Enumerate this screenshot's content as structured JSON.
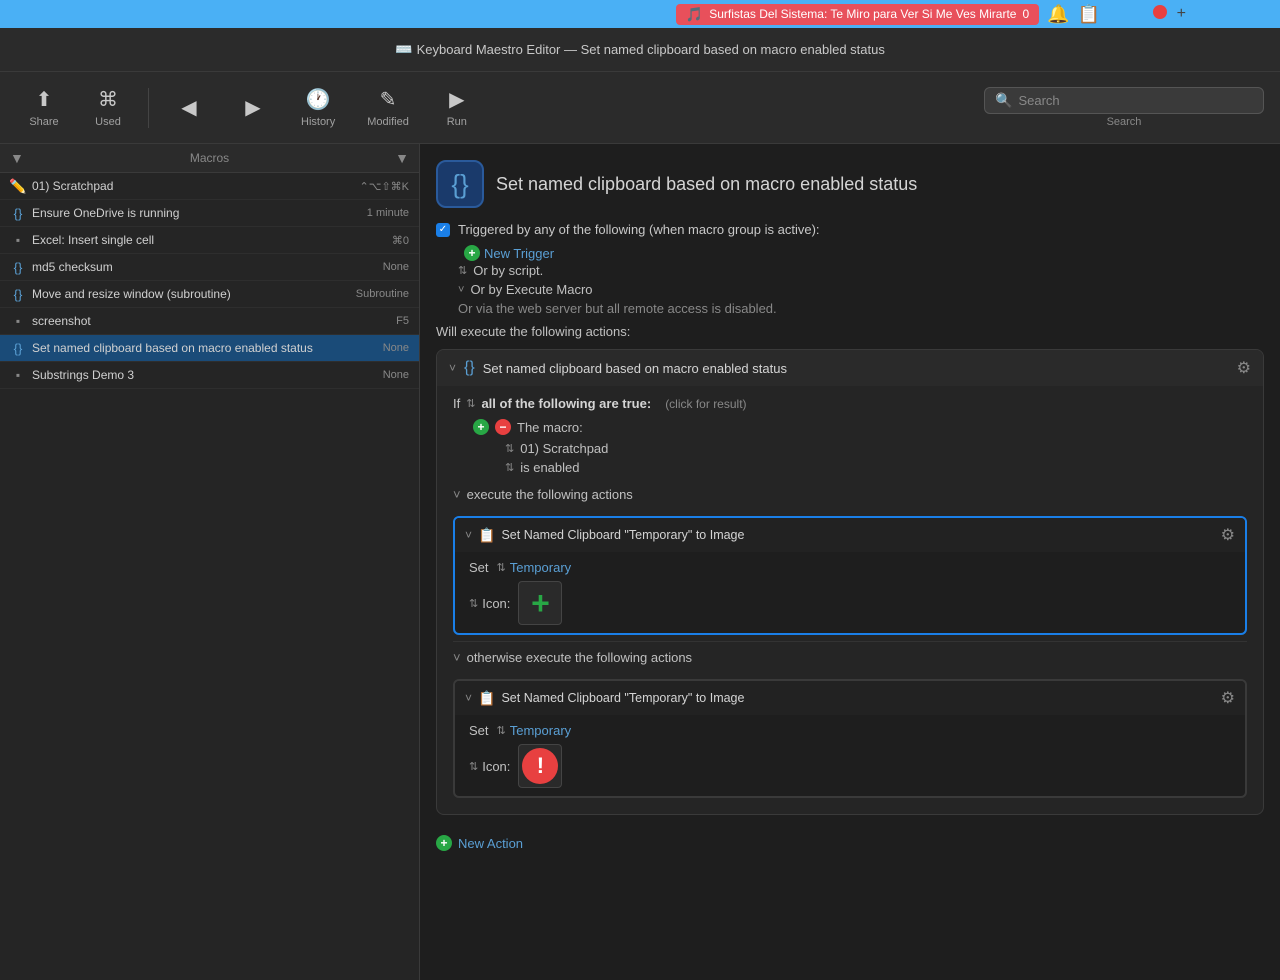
{
  "menubar": {
    "music_title": "Surfistas Del Sistema: Te Miro para Ver Si Me Ves Mirarte",
    "music_count": "0"
  },
  "titlebar": {
    "title": "Keyboard Maestro Editor — Set named clipboard based on macro enabled status"
  },
  "toolbar": {
    "share_label": "Share",
    "used_label": "Used",
    "history_label": "History",
    "modified_label": "Modified",
    "run_label": "Run",
    "search_placeholder": "Search",
    "search_label": "Search"
  },
  "sidebar": {
    "header": "Macros",
    "macros": [
      {
        "name": "01) Scratchpad",
        "shortcut": "⌃⌥⇧⌘K",
        "icon": "pencil",
        "selected": false
      },
      {
        "name": "Ensure OneDrive is running",
        "shortcut": "1 minute",
        "icon": "curly",
        "selected": false
      },
      {
        "name": "Excel: Insert single cell",
        "shortcut": "⌘0",
        "icon": "grid",
        "selected": false
      },
      {
        "name": "md5 checksum",
        "shortcut": "None",
        "icon": "curly",
        "selected": false
      },
      {
        "name": "Move and resize window (subroutine)",
        "shortcut": "Subroutine",
        "icon": "curly",
        "selected": false
      },
      {
        "name": "screenshot",
        "shortcut": "F5",
        "icon": "grid",
        "selected": false
      },
      {
        "name": "Set named clipboard based on macro enabled status",
        "shortcut": "None",
        "icon": "curly",
        "selected": true
      },
      {
        "name": "Substrings Demo 3",
        "shortcut": "None",
        "icon": "grid",
        "selected": false
      }
    ]
  },
  "content": {
    "macro_title": "Set named clipboard based on macro enabled status",
    "trigger_text": "Triggered by any of the following (when macro group is active):",
    "new_trigger_label": "New Trigger",
    "or_by_script": "Or by script.",
    "or_by_execute_macro": "Or by Execute Macro",
    "web_server_text": "Or via the web server but all remote access is disabled.",
    "will_execute_text": "Will execute the following actions:",
    "action_block_title": "Set named clipboard based on macro enabled status",
    "if_keyword": "If",
    "all_of_following": "all of the following are true:",
    "click_result": "(click for result)",
    "the_macro_label": "The macro:",
    "scratchpad_name": "01) Scratchpad",
    "is_enabled_label": "is enabled",
    "execute_following": "execute the following actions",
    "named_clipboard_title_1": "Set Named Clipboard \"Temporary\" to Image",
    "set_label": "Set",
    "temporary_value": "Temporary",
    "icon_label": "Icon:",
    "otherwise_execute": "otherwise execute the following actions",
    "named_clipboard_title_2": "Set Named Clipboard \"Temporary\" to Image",
    "new_action_label": "New Action"
  }
}
